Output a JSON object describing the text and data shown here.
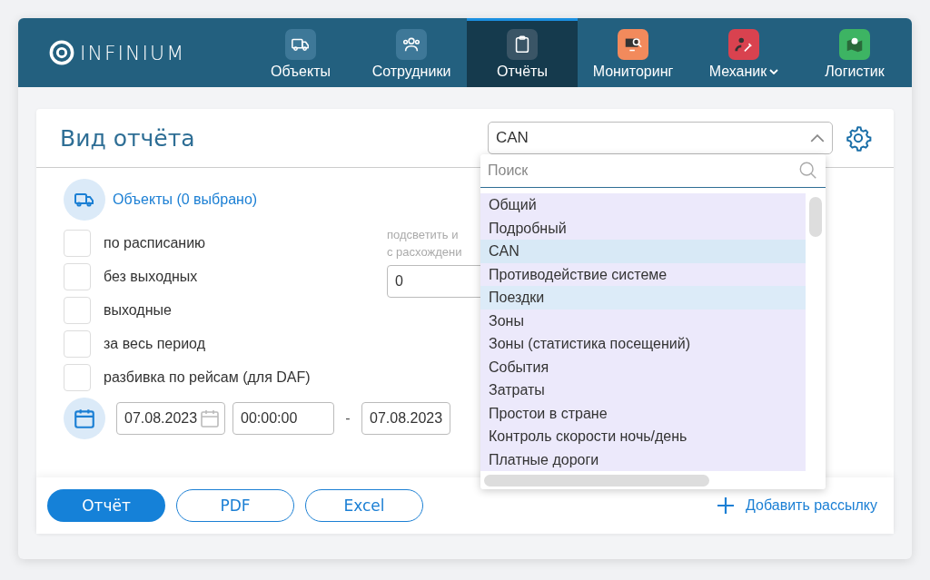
{
  "brand": {
    "name": "INFINIUM"
  },
  "nav": [
    {
      "label": "Объекты",
      "kind": "truck",
      "color": "#3e7898",
      "selected": false,
      "caret": false
    },
    {
      "label": "Сотрудники",
      "kind": "people",
      "color": "#3e7898",
      "selected": false,
      "caret": false
    },
    {
      "label": "Отчёты",
      "kind": "clipboard",
      "color": "#3a5566",
      "selected": true,
      "caret": false
    },
    {
      "label": "Мониторинг",
      "kind": "monitor",
      "color": "#f28a5c",
      "selected": false,
      "caret": false
    },
    {
      "label": "Механик",
      "kind": "mechanic",
      "color": "#d9424f",
      "selected": false,
      "caret": true
    },
    {
      "label": "Логистик",
      "kind": "map",
      "color": "#3db463",
      "selected": false,
      "caret": false
    }
  ],
  "report": {
    "title": "Вид отчёта",
    "select_value": "CAN",
    "objects_link": "Объекты (0 выбрано)",
    "options": [
      {
        "label": "по расписанию",
        "checked": false
      },
      {
        "label": "без выходных",
        "checked": false
      },
      {
        "label": "выходные",
        "checked": false
      },
      {
        "label": "за весь период",
        "checked": false
      },
      {
        "label": "разбивка по рейсам (для DAF)",
        "checked": false
      }
    ],
    "highlight_label": [
      "подсветить и",
      "с расхождени"
    ],
    "highlight_value": "0",
    "date_from": "07.08.2023",
    "time_from": "00:00:00",
    "date_separator": "-",
    "date_to": "07.08.2023"
  },
  "dropdown": {
    "search_placeholder": "Поиск",
    "expanded": true,
    "items": [
      {
        "label": "Общий",
        "selected": false,
        "highlighted": false
      },
      {
        "label": "Подробный",
        "selected": false,
        "highlighted": false
      },
      {
        "label": "CAN",
        "selected": true,
        "highlighted": false
      },
      {
        "label": "Противодействие системе",
        "selected": false,
        "highlighted": false
      },
      {
        "label": "Поездки",
        "selected": false,
        "highlighted": true
      },
      {
        "label": "Зоны",
        "selected": false,
        "highlighted": false
      },
      {
        "label": "Зоны (статистика посещений)",
        "selected": false,
        "highlighted": false
      },
      {
        "label": "События",
        "selected": false,
        "highlighted": false
      },
      {
        "label": "Затраты",
        "selected": false,
        "highlighted": false
      },
      {
        "label": "Простои в стране",
        "selected": false,
        "highlighted": false
      },
      {
        "label": "Контроль скорости ночь/день",
        "selected": false,
        "highlighted": false
      },
      {
        "label": "Платные дороги",
        "selected": false,
        "highlighted": false
      }
    ]
  },
  "footer": {
    "buttons": [
      {
        "label": "Отчёт",
        "kind": "primary"
      },
      {
        "label": "PDF",
        "kind": "outline"
      },
      {
        "label": "Excel",
        "kind": "outline"
      }
    ],
    "add_mailing": "Добавить рассылку"
  }
}
